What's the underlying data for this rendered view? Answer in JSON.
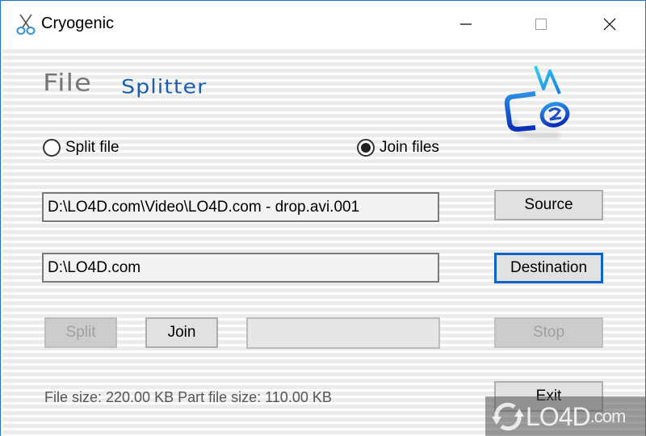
{
  "window": {
    "title": "Cryogenic",
    "icon": "scissors-icon",
    "controls": {
      "minimize": "minimize-icon",
      "maximize": "maximize-icon",
      "close": "close-icon"
    }
  },
  "header": {
    "logo_word1": "File",
    "logo_word2": "Splitter",
    "brand_logo": "cnz-logo"
  },
  "mode": {
    "options": [
      {
        "label": "Split file",
        "selected": false
      },
      {
        "label": "Join files",
        "selected": true
      }
    ]
  },
  "fields": {
    "source_path": "D:\\LO4D.com\\Video\\LO4D.com - drop.avi.001",
    "destination_path": "D:\\LO4D.com"
  },
  "buttons": {
    "source": "Source",
    "destination": "Destination",
    "split": "Split",
    "join": "Join",
    "stop": "Stop",
    "exit": "Exit"
  },
  "progress": {
    "value": 0
  },
  "status": {
    "text": "File size: 220.00 KB  Part file size: 110.00 KB"
  },
  "watermark": {
    "text": "LO4D",
    "suffix": ".com"
  },
  "colors": {
    "accent": "#0a64c8",
    "logo_blue": "#1c5fb0",
    "logo_gray": "#777777",
    "window_border": "#1a73d9"
  }
}
